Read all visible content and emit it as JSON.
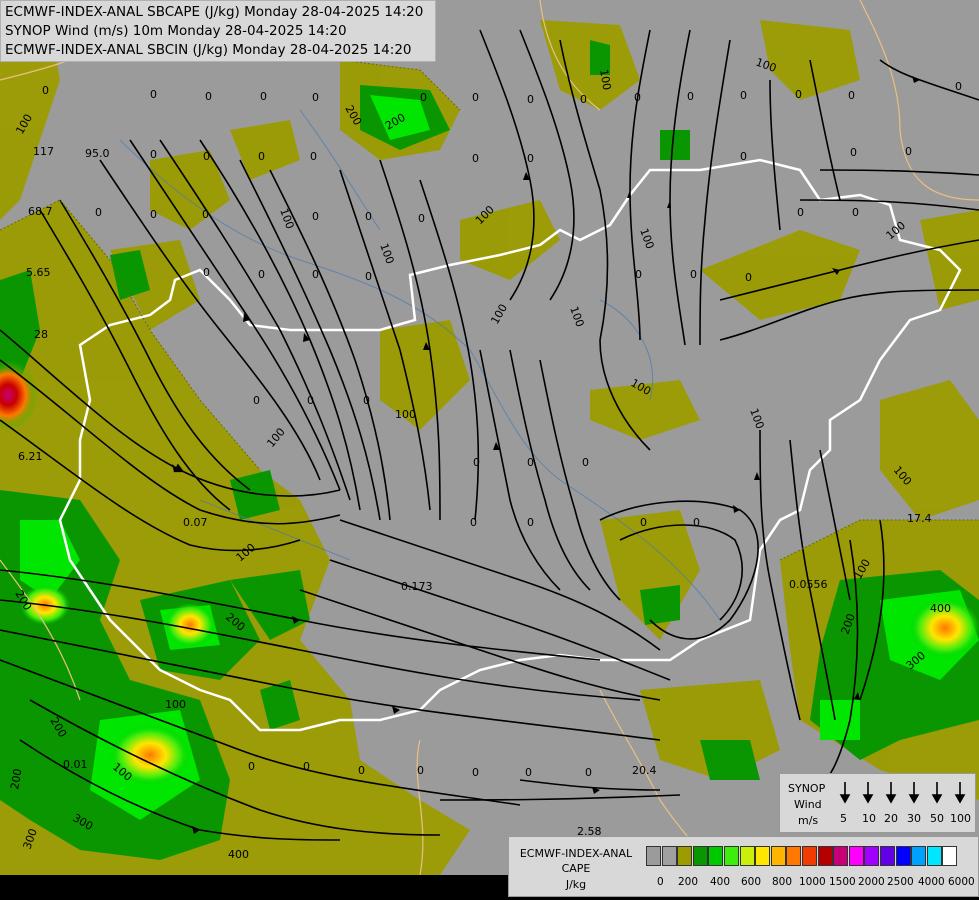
{
  "titles": [
    "ECMWF-INDEX-ANAL SBCAPE (J/kg) Monday 28-04-2025 14:20",
    "SYNOP Wind (m/s) 10m Monday 28-04-2025 14:20",
    "ECMWF-INDEX-ANAL SBCIN (J/kg) Monday 28-04-2025 14:20"
  ],
  "synop_legend": {
    "title_line1": "SYNOP",
    "title_line2": "Wind",
    "unit": "m/s",
    "values": [
      "5",
      "10",
      "20",
      "30",
      "50",
      "100"
    ]
  },
  "cape_legend": {
    "title_line1": "ECMWF-INDEX-ANAL",
    "title_line2": "CAPE",
    "unit": "J/kg",
    "ticks": [
      "0",
      "200",
      "400",
      "600",
      "800",
      "1000",
      "1500",
      "2000",
      "2500",
      "4000",
      "6000"
    ],
    "colors": [
      "#9b9b9b",
      "#a0a0a0",
      "#9c9c00",
      "#0a9600",
      "#00c800",
      "#3ced0d",
      "#c8f00a",
      "#ffe600",
      "#ffb400",
      "#ff7800",
      "#f03c00",
      "#b40000",
      "#c80078",
      "#ff00ff",
      "#a000ff",
      "#6400e6",
      "#0000ff",
      "#00a0ff",
      "#00e6ff",
      "#ffffff"
    ]
  },
  "map_colors": {
    "background": "#9b9b9b",
    "cape_low": "#9c9c00",
    "cape_green": "#1ea01e",
    "cape_bright": "#00e600",
    "cape_yellow": "#ffe600",
    "cape_orange": "#ff7800",
    "cape_red": "#c80000",
    "border": "#ffffff",
    "streamline": "#000000"
  },
  "labels": {
    "cape": [
      "0",
      "0",
      "0",
      "0",
      "0",
      "0",
      "0",
      "0",
      "0",
      "0",
      "0",
      "0",
      "0",
      "0",
      "0",
      "0",
      "0",
      "0",
      "0",
      "0",
      "0",
      "0",
      "0",
      "0",
      "0",
      "0",
      "0",
      "0",
      "0",
      "0",
      "0",
      "0",
      "0",
      "0",
      "0",
      "0",
      "0",
      "0",
      "0",
      "0",
      "0",
      "0",
      "0",
      "0",
      "0",
      "0",
      "0",
      "0",
      "0",
      "0",
      "0",
      "0",
      "0",
      "0",
      "0",
      "0"
    ],
    "cin": [
      "100",
      "100",
      "200",
      "200",
      "100",
      "100",
      "100",
      "100",
      "100",
      "100",
      "100",
      "100",
      "100",
      "100",
      "100",
      "200",
      "200",
      "200",
      "100",
      "100",
      "100",
      "300",
      "400",
      "400",
      "300",
      "200",
      "100",
      "200",
      "300",
      "100",
      "100"
    ],
    "values": [
      "117",
      "95.0",
      "68.7",
      "5.65",
      "28",
      "6.21",
      "0.07",
      "0.173",
      "0.0556",
      "17.4",
      "0.01",
      "20.4",
      "2.58"
    ]
  }
}
